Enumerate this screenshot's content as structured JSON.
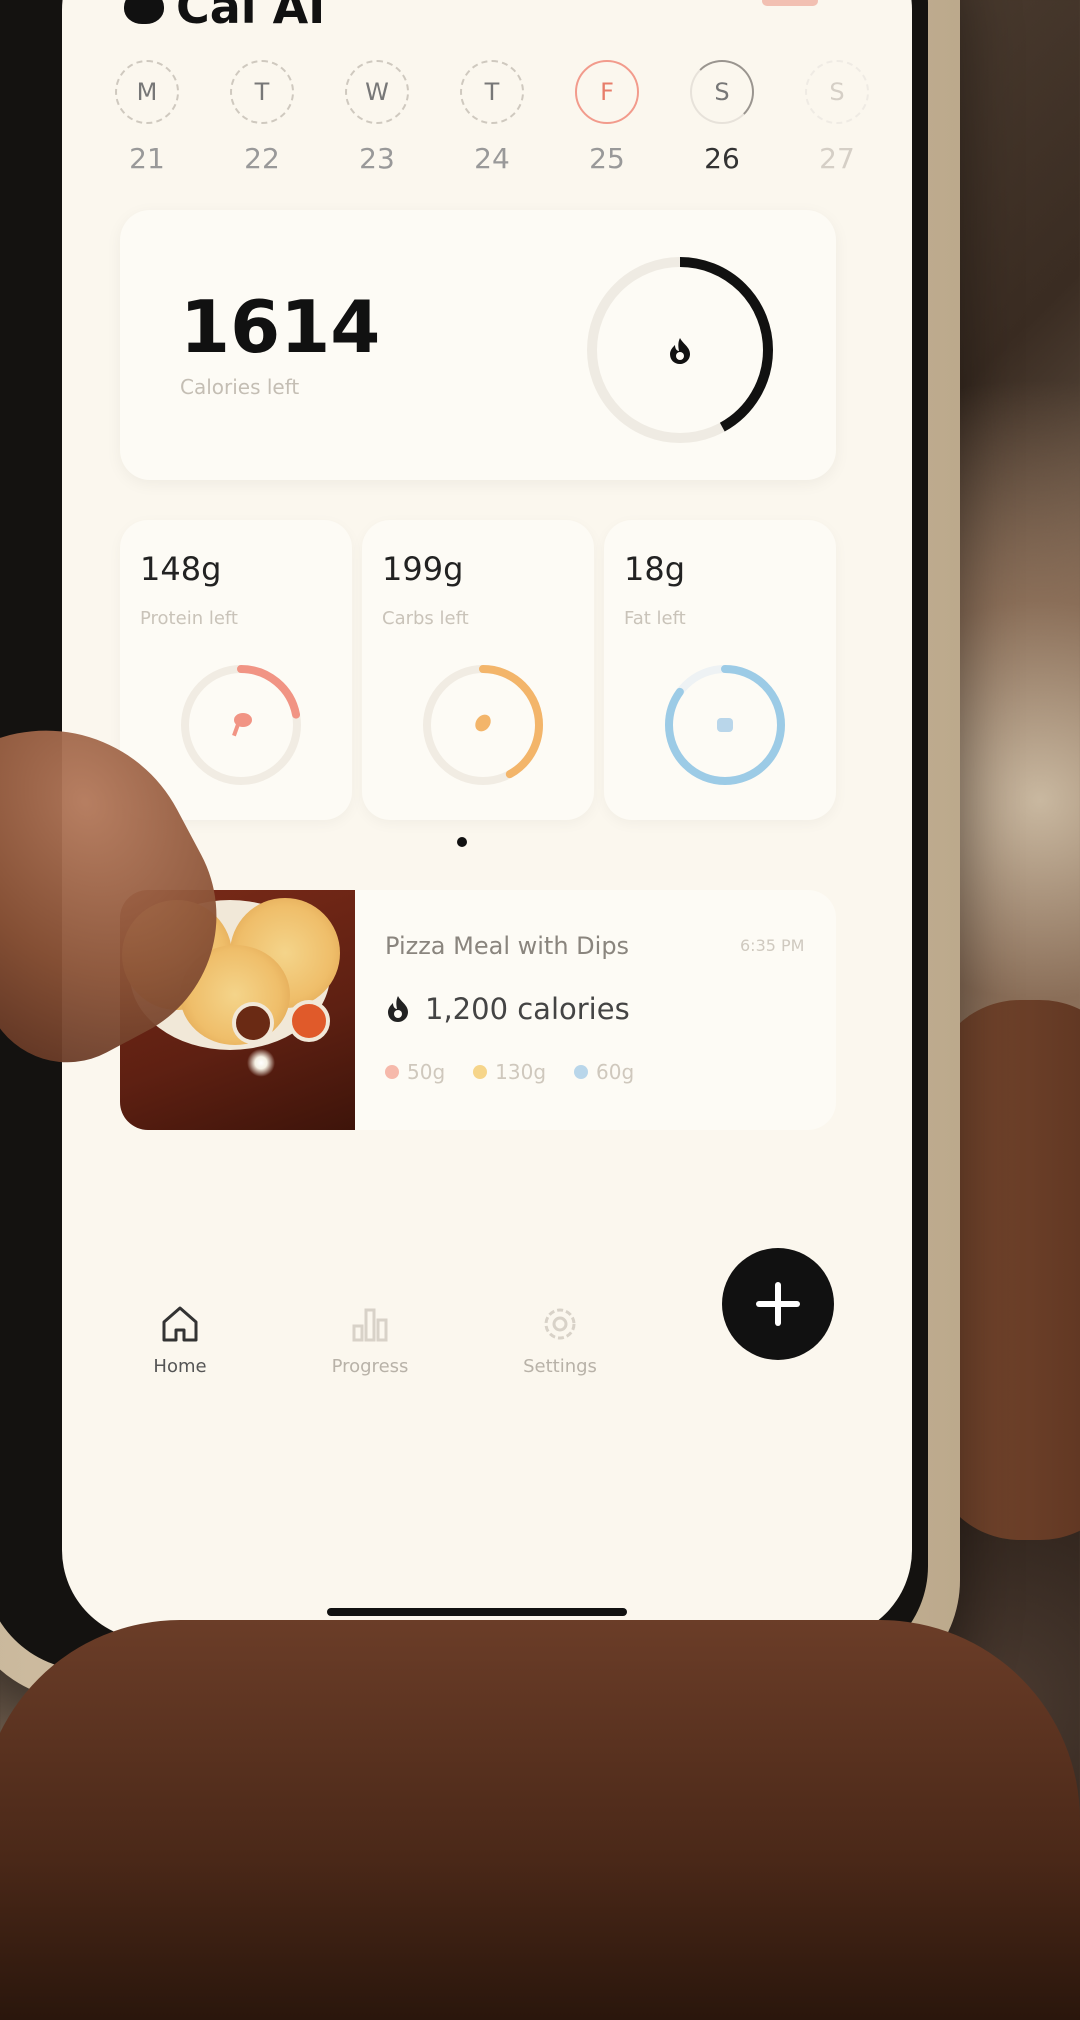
{
  "app": {
    "title": "Cal AI"
  },
  "week": [
    {
      "letter": "M",
      "num": "21",
      "state": "past"
    },
    {
      "letter": "T",
      "num": "22",
      "state": "past"
    },
    {
      "letter": "W",
      "num": "23",
      "state": "past"
    },
    {
      "letter": "T",
      "num": "24",
      "state": "past"
    },
    {
      "letter": "F",
      "num": "25",
      "state": "active"
    },
    {
      "letter": "S",
      "num": "26",
      "state": "today"
    },
    {
      "letter": "S",
      "num": "27",
      "state": "future"
    }
  ],
  "calories": {
    "value": "1614",
    "label": "Calories left",
    "ring_fill": 0.42,
    "ring_color": "#111111"
  },
  "macros": [
    {
      "id": "protein",
      "value": "148g",
      "label": "Protein left",
      "color": "#f19484",
      "fill": 0.22,
      "icon": "drumstick-icon"
    },
    {
      "id": "carbs",
      "value": "199g",
      "label": "Carbs left",
      "color": "#f3b56a",
      "fill": 0.42,
      "icon": "wheat-icon"
    },
    {
      "id": "fat",
      "value": "18g",
      "label": "Fat left",
      "color": "#9ccbe6",
      "fill": 0.85,
      "icon": "droplet-icon"
    }
  ],
  "meal": {
    "title": "Pizza Meal with Dips",
    "time": "6:35 PM",
    "calories": "1,200 calories",
    "protein": "50g",
    "carbs": "130g",
    "fat": "60g"
  },
  "tabs": [
    {
      "id": "home",
      "label": "Home",
      "active": true
    },
    {
      "id": "progress",
      "label": "Progress",
      "active": false
    },
    {
      "id": "settings",
      "label": "Settings",
      "active": false
    }
  ],
  "colors": {
    "accent": "#111111",
    "protein": "#f19484",
    "carbs": "#f3b56a",
    "fat": "#9ccbe6",
    "active_day": "#e77d6a"
  }
}
